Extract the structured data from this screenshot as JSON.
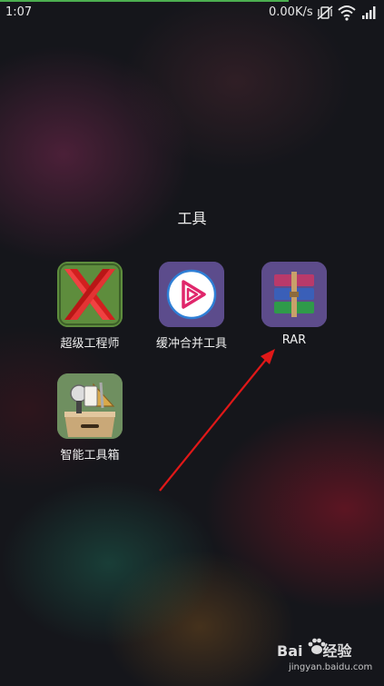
{
  "status_bar": {
    "time": "1:07",
    "network_speed": "0.00K/s",
    "icons": [
      "vibrate-off-icon",
      "wifi-icon",
      "signal-icon"
    ]
  },
  "folder": {
    "title": "工具",
    "apps": [
      {
        "label": "超级工程师",
        "icon": "super-engineer-icon"
      },
      {
        "label": "缓冲合并工具",
        "icon": "buffer-merge-icon"
      },
      {
        "label": "RAR",
        "icon": "rar-icon"
      },
      {
        "label": "智能工具箱",
        "icon": "smart-toolbox-icon"
      }
    ]
  },
  "watermark": {
    "brand_left": "Bai",
    "brand_right": "经验",
    "url": "jingyan.baidu.com"
  },
  "colors": {
    "annotation_arrow": "#e01818",
    "status_progress": "#4caf50"
  }
}
